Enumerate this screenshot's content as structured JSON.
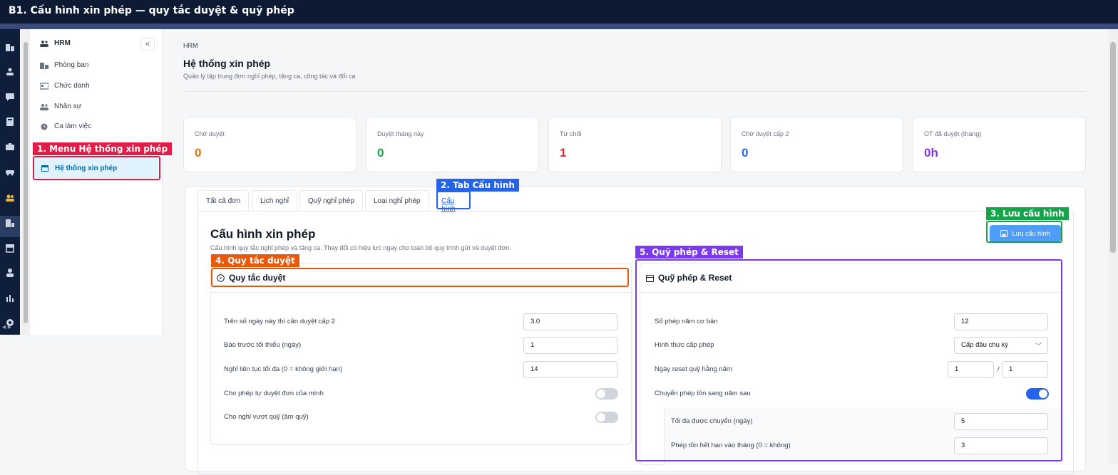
{
  "top_title": "B1. Cấu hình xin phép — quy tắc duyệt & quỹ phép",
  "sidebar": {
    "title": "HRM",
    "collapse": "«",
    "items": [
      {
        "label": "Phòng ban",
        "icon": "building-icon"
      },
      {
        "label": "Chức danh",
        "icon": "id-card-icon"
      },
      {
        "label": "Nhân sự",
        "icon": "users-icon"
      },
      {
        "label": "Ca làm việc",
        "icon": "clock-icon"
      },
      {
        "label": "Hệ thống xin phép",
        "icon": "calendar-icon",
        "active": true
      }
    ]
  },
  "annotations": {
    "a1": "1. Menu Hệ thống xin phép",
    "a2": "2. Tab Cấu hình",
    "a3": "3. Lưu cấu hình",
    "a4": "4. Quy tắc duyệt",
    "a5": "5. Quỹ phép & Reset",
    "colors": {
      "a1": "#e11d48",
      "a2": "#2563eb",
      "a3": "#16a34a",
      "a4": "#ea580c",
      "a5": "#7c3aed"
    }
  },
  "page": {
    "breadcrumb": "HRM",
    "title": "Hệ thống xin phép",
    "subtitle": "Quản lý tập trung đơn nghỉ phép, tăng ca, công tác và đổi ca"
  },
  "stats": [
    {
      "label": "Chờ duyệt",
      "value": "0",
      "color": "#d97706"
    },
    {
      "label": "Duyệt tháng này",
      "value": "0",
      "color": "#16a34a"
    },
    {
      "label": "Từ chối",
      "value": "1",
      "color": "#dc2626"
    },
    {
      "label": "Chờ duyệt cấp 2",
      "value": "0",
      "color": "#2563eb"
    },
    {
      "label": "OT đã duyệt (tháng)",
      "value": "0h",
      "color": "#7c3aed"
    }
  ],
  "tabs": [
    "Tất cả đơn",
    "Lịch nghỉ",
    "Quỹ nghỉ phép",
    "Loại nghỉ phép",
    "Cấu hình"
  ],
  "config": {
    "title": "Cấu hình xin phép",
    "subtitle": "Cấu hình quy tắc nghỉ phép và tăng ca. Thay đổi có hiệu lực ngay cho toàn bộ quy trình gửi và duyệt đơn.",
    "save_label": "Lưu cấu hình",
    "rules": {
      "title": "Quy tắc duyệt",
      "rows": [
        {
          "label": "Trên số ngày này thì cần duyệt cấp 2",
          "value": "3.0"
        },
        {
          "label": "Báo trước tối thiểu (ngày)",
          "value": "1"
        },
        {
          "label": "Nghỉ liên tục tối đa (0 = không giới hạn)",
          "value": "14"
        }
      ],
      "toggles": [
        {
          "label": "Cho phép tự duyệt đơn của mình",
          "on": false
        },
        {
          "label": "Cho nghỉ vượt quỹ (âm quỹ)",
          "on": false
        }
      ]
    },
    "quota": {
      "title": "Quỹ phép & Reset",
      "base_label": "Số phép năm cơ bản",
      "base_value": "12",
      "grant_label": "Hình thức cấp phép",
      "grant_value": "Cấp đầu chu kỳ",
      "reset_label": "Ngày reset quỹ hằng năm",
      "reset_day": "1",
      "reset_sep": "/",
      "reset_month": "1",
      "carry_label": "Chuyển phép tồn sang năm sau",
      "carry_on": true,
      "max_carry_label": "Tối đa được chuyển (ngày)",
      "max_carry_value": "5",
      "expire_label": "Phép tồn hết hạn vào tháng (0 = không)",
      "expire_value": "3"
    }
  }
}
